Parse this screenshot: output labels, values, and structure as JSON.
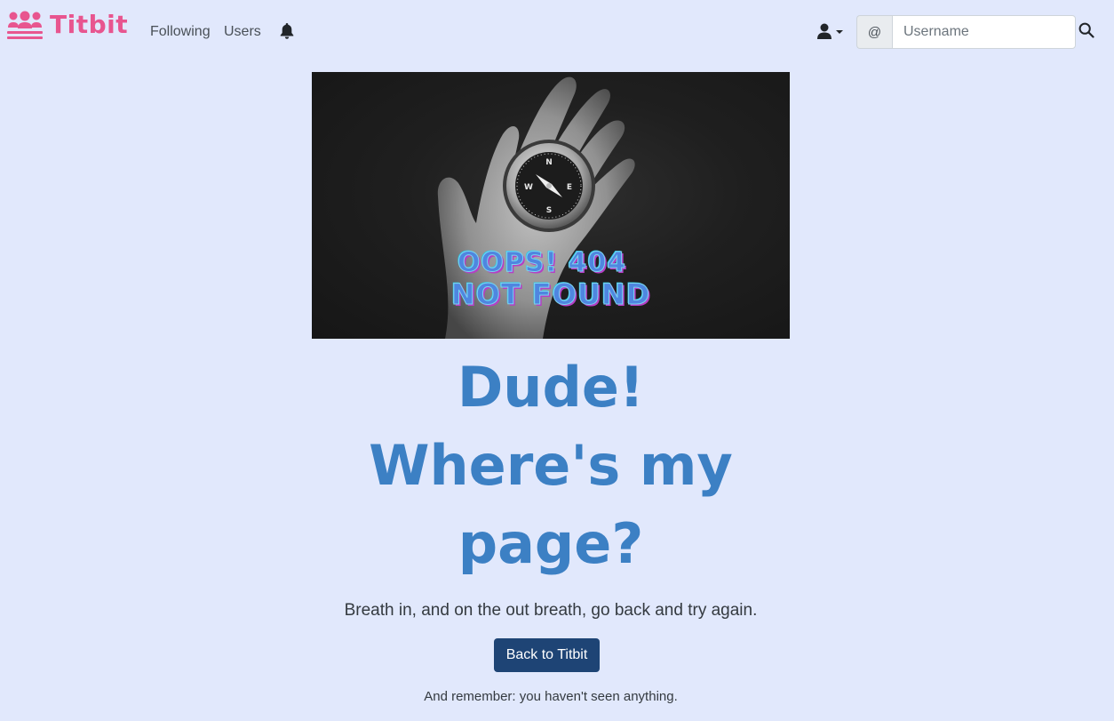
{
  "brand": {
    "name": "Titbit",
    "color": "#e8558f"
  },
  "nav": {
    "links": [
      {
        "label": "Following"
      },
      {
        "label": "Users"
      }
    ],
    "bell_icon": "bell-icon",
    "user_icon": "user-icon"
  },
  "search": {
    "addon": "@",
    "placeholder": "Username",
    "value": "",
    "icon": "search-icon"
  },
  "hero": {
    "line1": "OOPS! 404",
    "line2": "NOT FOUND"
  },
  "main": {
    "headline_lines": [
      "Dude!",
      "Where's my",
      "page?"
    ],
    "headline_color": "#3c80c4",
    "tagline": "Breath in, and on the out breath, go back and try again.",
    "back_button": "Back to Titbit",
    "back_button_color": "#1e4475",
    "remember": "And remember: you haven't seen anything."
  },
  "colors": {
    "background": "#e1e8fc"
  }
}
